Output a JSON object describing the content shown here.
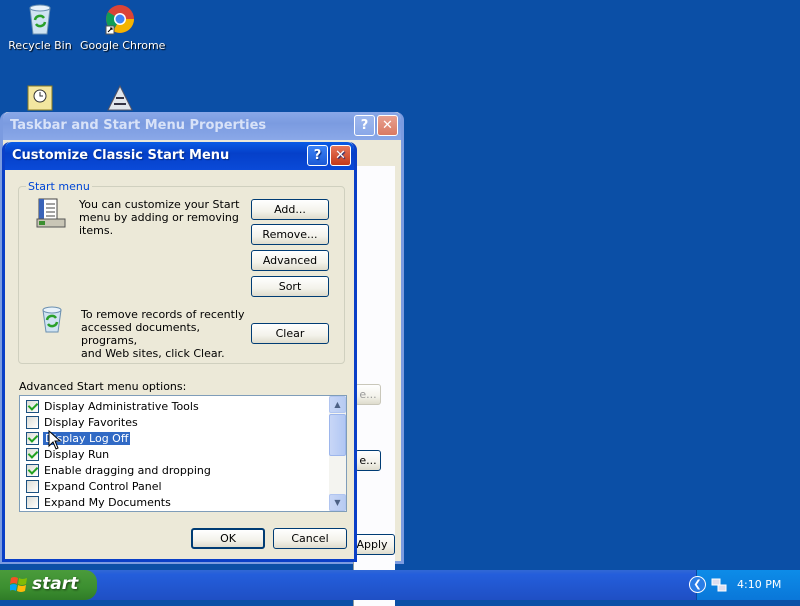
{
  "desktop": {
    "icons": [
      {
        "label": "Recycle Bin",
        "icon": "recycle-bin-icon"
      },
      {
        "label": "Google Chrome",
        "icon": "chrome-icon"
      }
    ]
  },
  "back_window": {
    "title": "Taskbar and Start Menu Properties",
    "partial_button_1": "e...",
    "partial_button_2": "e...",
    "apply_label": "Apply"
  },
  "dialog": {
    "title": "Customize Classic Start Menu",
    "group_label": "Start menu",
    "customize_text": [
      "You can customize your Start",
      "menu by adding or removing",
      "items."
    ],
    "remove_text": [
      "To remove records of recently",
      "accessed documents, programs,",
      "and Web sites, click Clear."
    ],
    "buttons": {
      "add": "Add...",
      "remove": "Remove...",
      "advanced": "Advanced",
      "sort": "Sort",
      "clear": "Clear"
    },
    "options_label": "Advanced Start menu options:",
    "options": [
      {
        "label": "Display Administrative Tools",
        "checked": true
      },
      {
        "label": "Display Favorites",
        "checked": false
      },
      {
        "label": "Display Log Off",
        "checked": true,
        "selected": true
      },
      {
        "label": "Display Run",
        "checked": true
      },
      {
        "label": "Enable dragging and dropping",
        "checked": true
      },
      {
        "label": "Expand Control Panel",
        "checked": false
      },
      {
        "label": "Expand My Documents",
        "checked": false
      }
    ],
    "ok_label": "OK",
    "cancel_label": "Cancel"
  },
  "taskbar": {
    "start_label": "start",
    "clock": "4:10 PM"
  },
  "colors": {
    "desktop": "#0b4fa6",
    "titlebar": "#0a5ce6",
    "selection": "#316ac5"
  }
}
